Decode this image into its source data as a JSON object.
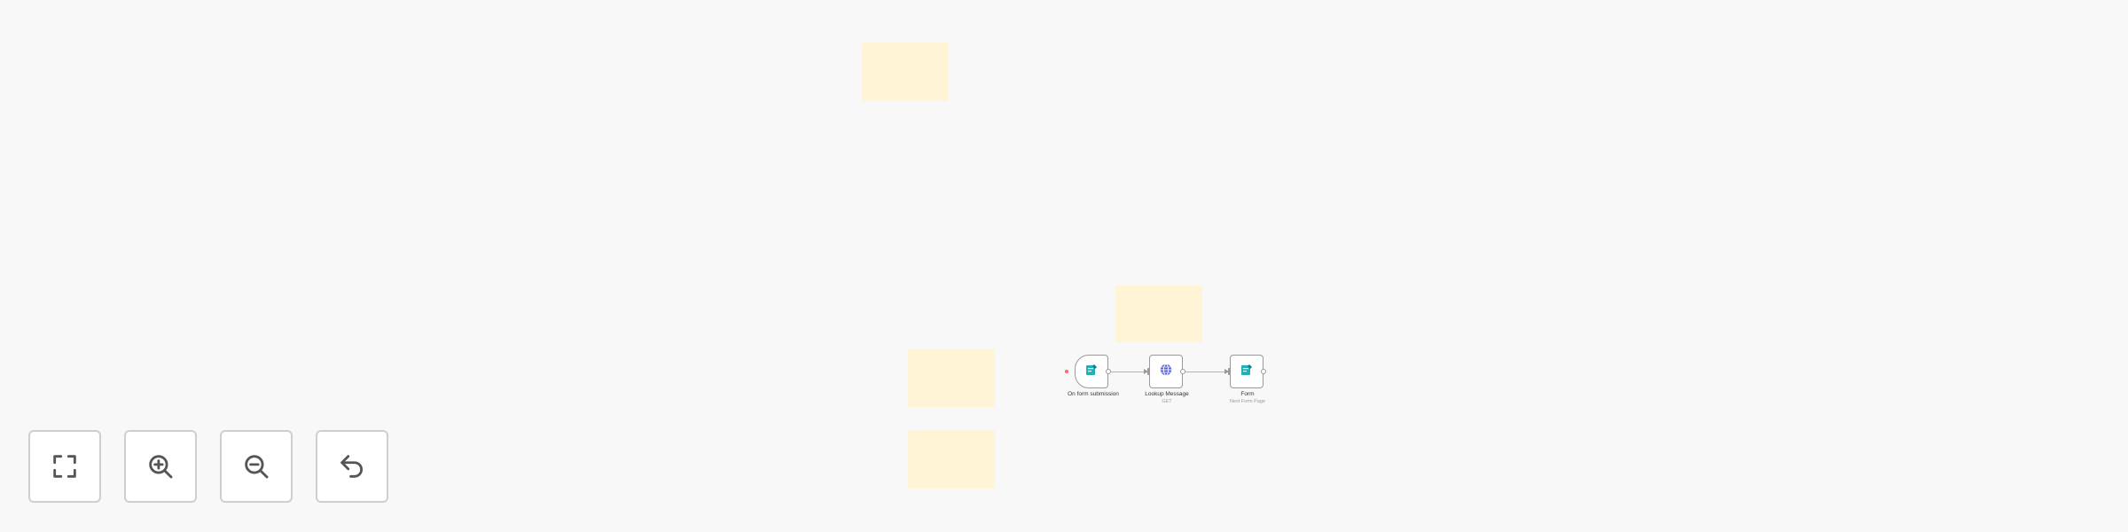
{
  "workflow": {
    "nodes": [
      {
        "id": "trigger",
        "label": "On form submission",
        "subtitle": "",
        "icon": "form-icon",
        "icon_color": "#1fb0b8"
      },
      {
        "id": "http",
        "label": "Lookup Message",
        "subtitle": "GET",
        "icon": "globe-icon",
        "icon_color": "#5b66d6"
      },
      {
        "id": "form",
        "label": "Form",
        "subtitle": "Next Form Page",
        "icon": "form-icon",
        "icon_color": "#1fb0b8"
      }
    ]
  },
  "controls": [
    {
      "name": "zoom-to-fit-button",
      "icon": "fit-view-icon"
    },
    {
      "name": "zoom-in-button",
      "icon": "zoom-in-icon"
    },
    {
      "name": "zoom-out-button",
      "icon": "zoom-out-icon"
    },
    {
      "name": "undo-button",
      "icon": "undo-icon"
    }
  ],
  "colors": {
    "canvas_bg": "#f8f8f8",
    "sticky_note": "#fff5d6",
    "node_border": "#9a9a9a",
    "trigger_dot": "#ff6d5a",
    "icon_stroke": "#555555"
  }
}
